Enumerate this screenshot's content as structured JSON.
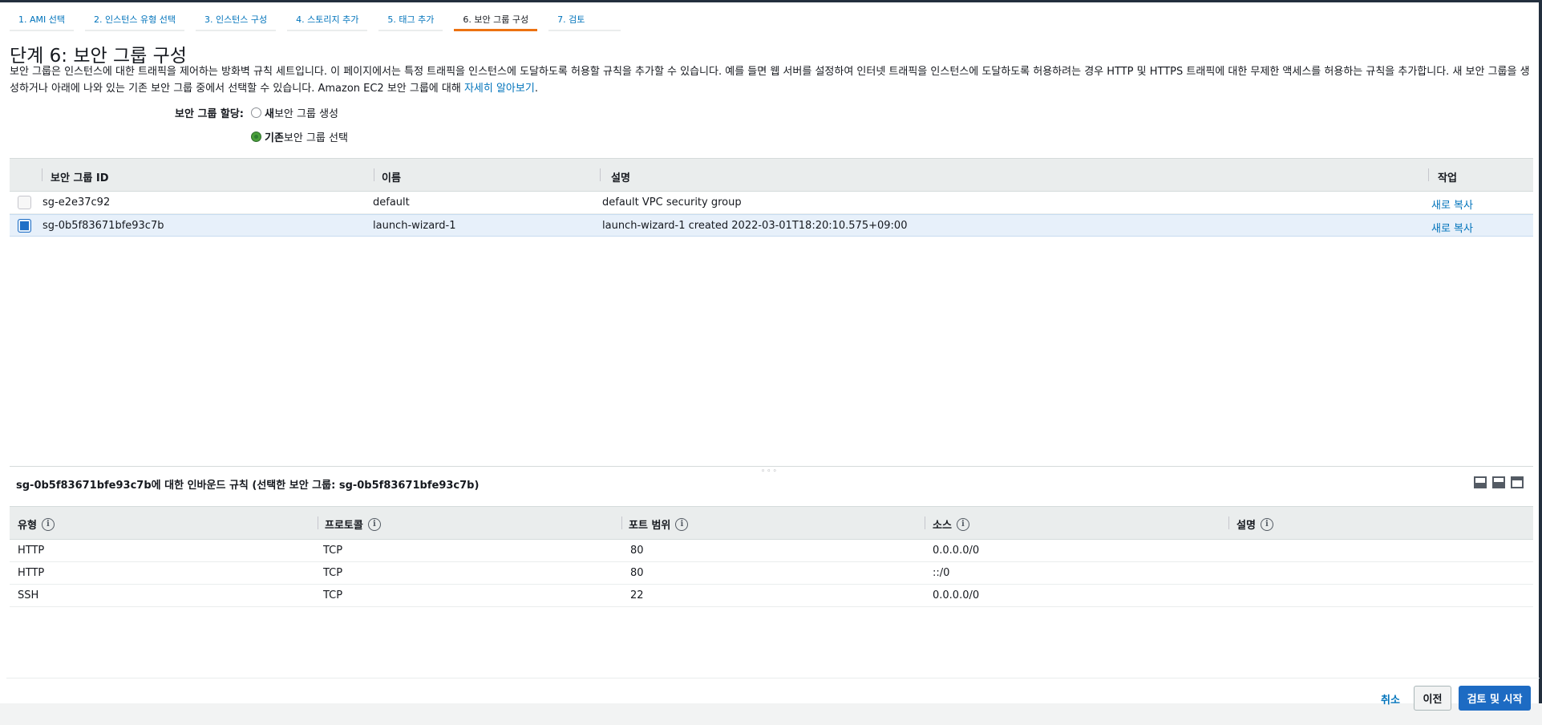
{
  "tabs": [
    {
      "label": "1. AMI 선택"
    },
    {
      "label": "2. 인스턴스 유형 선택"
    },
    {
      "label": "3. 인스턴스 구성"
    },
    {
      "label": "4. 스토리지 추가"
    },
    {
      "label": "5. 태그 추가"
    },
    {
      "label": "6. 보안 그룹 구성",
      "active": true
    },
    {
      "label": "7. 검토"
    }
  ],
  "page": {
    "title": "단계 6: 보안 그룹 구성",
    "description_main": "보안 그룹은 인스턴스에 대한 트래픽을 제어하는 방화벽 규칙 세트입니다. 이 페이지에서는 특정 트래픽을 인스턴스에 도달하도록 허용할 규칙을 추가할 수 있습니다. 예를 들면 웹 서버를 설정하여 인터넷 트래픽을 인스턴스에 도달하도록 허용하려는 경우 HTTP 및 HTTPS 트래픽에 대한 무제한 액세스를 허용하는 규칙을 추가합니다. 새 보안 그룹을 생성하거나 아래에 나와 있는 기존 보안 그룹 중에서 선택할 수 있습니다. Amazon EC2 보안 그룹에 대해 ",
    "learn_more": "자세히 알아보기",
    "description_end": "."
  },
  "assignment": {
    "label": "보안 그룹 할당:",
    "option_new_bold": "새",
    "option_new_rest": " 보안 그룹 생성",
    "option_existing_bold": "기존",
    "option_existing_rest": " 보안 그룹 선택",
    "selected": "existing"
  },
  "sg_table": {
    "headers": {
      "id": "보안 그룹 ID",
      "name": "이름",
      "description": "설명",
      "action": "작업"
    },
    "rows": [
      {
        "id": "sg-e2e37c92",
        "name": "default",
        "description": "default VPC security group",
        "action": "새로 복사",
        "checked": false
      },
      {
        "id": "sg-0b5f83671bfe93c7b",
        "name": "launch-wizard-1",
        "description": "launch-wizard-1 created 2022-03-01T18:20:10.575+09:00",
        "action": "새로 복사",
        "checked": true
      }
    ]
  },
  "rules": {
    "title": "sg-0b5f83671bfe93c7b에 대한 인바운드 규칙 (선택한 보안 그룹: sg-0b5f83671bfe93c7b)",
    "headers": {
      "type": "유형",
      "protocol": "프로토콜",
      "port": "포트 범위",
      "source": "소스",
      "description": "설명"
    },
    "rows": [
      {
        "type": "HTTP",
        "protocol": "TCP",
        "port": "80",
        "source": "0.0.0.0/0",
        "description": ""
      },
      {
        "type": "HTTP",
        "protocol": "TCP",
        "port": "80",
        "source": "::/0",
        "description": ""
      },
      {
        "type": "SSH",
        "protocol": "TCP",
        "port": "22",
        "source": "0.0.0.0/0",
        "description": ""
      }
    ]
  },
  "footer": {
    "cancel": "취소",
    "previous": "이전",
    "review_launch": "검토 및 시작"
  },
  "icons": {
    "info": "i",
    "grip": "◦◦◦"
  },
  "colors": {
    "link": "#0073bb",
    "active_tab": "#ec7211",
    "primary_button": "#1d6bc3"
  }
}
